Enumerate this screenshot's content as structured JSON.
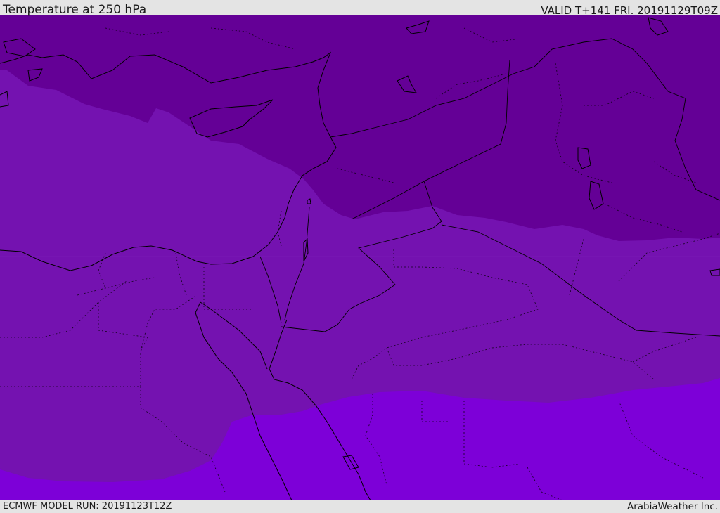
{
  "header": {
    "title": "Temperature at 250 hPa",
    "valid_time": "VALID T+141 FRI. 20191129T09Z"
  },
  "footer": {
    "model_run": "ECMWF MODEL RUN: 20191123T12Z",
    "credit": "ArabiaWeather Inc."
  },
  "map": {
    "layer": "temperature-250hPa-shading",
    "colors": {
      "cold_band": "#640096",
      "mid_band": "#7412b0",
      "warm_band": "#7d00d8",
      "coastline": "#000000",
      "border": "#000000"
    }
  }
}
